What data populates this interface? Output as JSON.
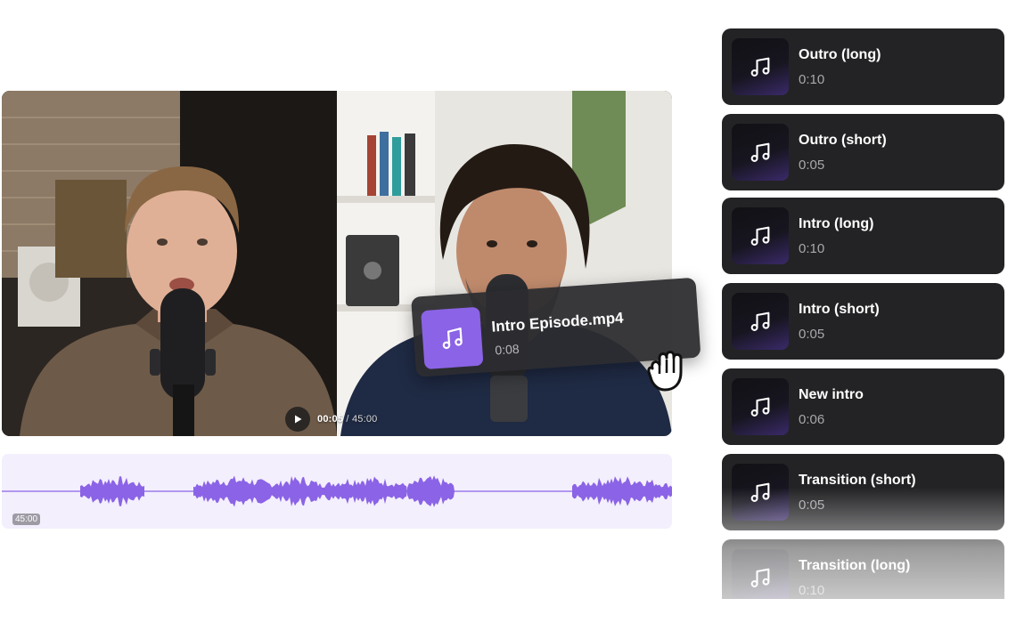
{
  "player": {
    "current_time": "00:05",
    "separator": "/",
    "total_time": "45:00",
    "play_icon": "play-icon"
  },
  "waveform": {
    "time_label": "45:00",
    "color": "#8b63e6",
    "background": "#f3effd"
  },
  "dragged_clip": {
    "name": "Intro Episode.mp4",
    "duration": "0:08",
    "icon": "music-note-icon",
    "accent": "#8b63e6"
  },
  "audio_list": {
    "items": [
      {
        "title": "Outro (long)",
        "duration": "0:10"
      },
      {
        "title": "Outro (short)",
        "duration": "0:05"
      },
      {
        "title": "Intro (long)",
        "duration": "0:10"
      },
      {
        "title": "Intro (short)",
        "duration": "0:05"
      },
      {
        "title": "New intro",
        "duration": "0:06"
      },
      {
        "title": "Transition (short)",
        "duration": "0:05"
      },
      {
        "title": "Transition (long)",
        "duration": "0:10"
      }
    ]
  }
}
